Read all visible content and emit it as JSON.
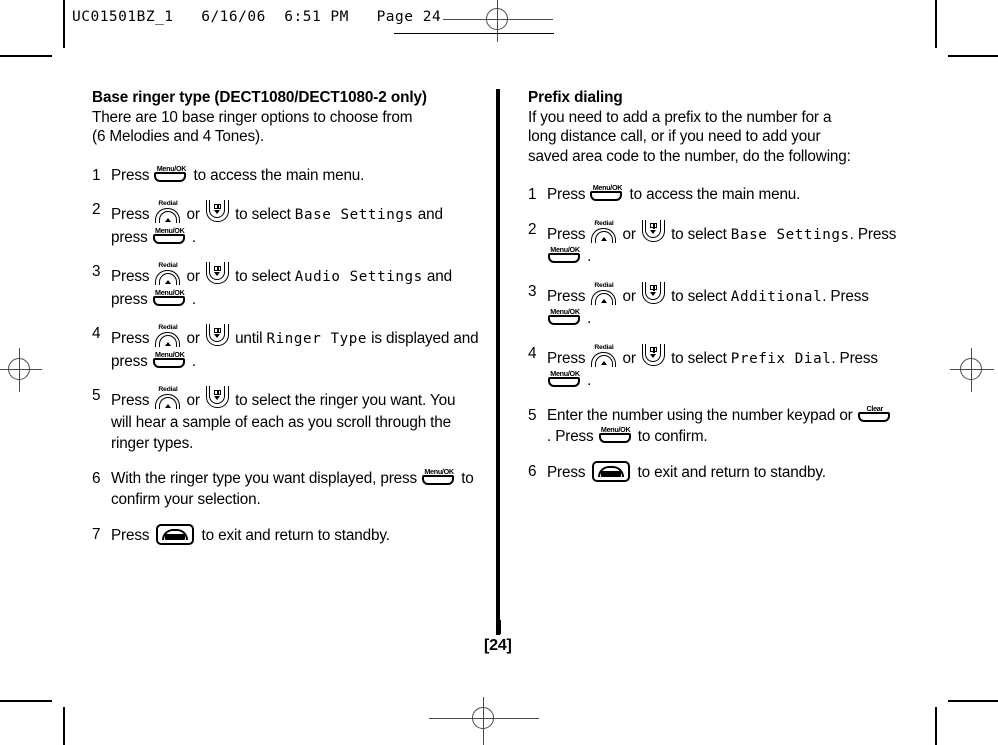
{
  "print_header": {
    "text": "UC01501BZ_1   6/16/06  6:51 PM   Page 24"
  },
  "left_column": {
    "title": "Base ringer type (DECT1080/DECT1080-2 only)",
    "intro_line1": "There are 10 base ringer options to choose from",
    "intro_line2": "(6 Melodies and 4 Tones).",
    "steps": [
      {
        "num": "1",
        "parts": [
          {
            "t": "text",
            "v": "Press "
          },
          {
            "t": "key-menuok",
            "v": "Menu/OK"
          },
          {
            "t": "text",
            "v": " to access the main menu."
          }
        ]
      },
      {
        "num": "2",
        "parts": [
          {
            "t": "text",
            "v": "Press "
          },
          {
            "t": "key-up",
            "v": "Redial"
          },
          {
            "t": "text",
            "v": " or "
          },
          {
            "t": "key-down",
            "v": "Phonebook Down"
          },
          {
            "t": "text",
            "v": " to select "
          },
          {
            "t": "lcd",
            "v": "Base Settings"
          },
          {
            "t": "text",
            "v": " and press "
          },
          {
            "t": "key-menuok",
            "v": "Menu/OK"
          },
          {
            "t": "text",
            "v": " ."
          }
        ]
      },
      {
        "num": "3",
        "parts": [
          {
            "t": "text",
            "v": "Press "
          },
          {
            "t": "key-up",
            "v": "Redial"
          },
          {
            "t": "text",
            "v": " or "
          },
          {
            "t": "key-down",
            "v": "Phonebook Down"
          },
          {
            "t": "text",
            "v": " to select "
          },
          {
            "t": "lcd",
            "v": "Audio Settings"
          },
          {
            "t": "text",
            "v": " and press "
          },
          {
            "t": "key-menuok",
            "v": "Menu/OK"
          },
          {
            "t": "text",
            "v": " ."
          }
        ]
      },
      {
        "num": "4",
        "parts": [
          {
            "t": "text",
            "v": "Press "
          },
          {
            "t": "key-up",
            "v": "Redial"
          },
          {
            "t": "text",
            "v": " or "
          },
          {
            "t": "key-down",
            "v": "Phonebook Down"
          },
          {
            "t": "text",
            "v": " until "
          },
          {
            "t": "lcd",
            "v": "Ringer Type"
          },
          {
            "t": "text",
            "v": " is displayed and press "
          },
          {
            "t": "key-menuok",
            "v": "Menu/OK"
          },
          {
            "t": "text",
            "v": " ."
          }
        ]
      },
      {
        "num": "5",
        "parts": [
          {
            "t": "text",
            "v": "Press "
          },
          {
            "t": "key-up",
            "v": "Redial"
          },
          {
            "t": "text",
            "v": " or "
          },
          {
            "t": "key-down",
            "v": "Phonebook Down"
          },
          {
            "t": "text",
            "v": " to select the ringer you want. You will hear a sample of each as you scroll through the ringer types."
          }
        ]
      },
      {
        "num": "6",
        "parts": [
          {
            "t": "text",
            "v": "With the ringer type you want displayed, press "
          },
          {
            "t": "key-menuok",
            "v": "Menu/OK"
          },
          {
            "t": "text",
            "v": " to confirm your selection."
          }
        ]
      },
      {
        "num": "7",
        "parts": [
          {
            "t": "text",
            "v": "Press "
          },
          {
            "t": "key-end",
            "v": "End Call"
          },
          {
            "t": "text",
            "v": " to exit and return to standby."
          }
        ]
      }
    ]
  },
  "right_column": {
    "title": "Prefix dialing",
    "intro_line1": "If you need to add a prefix to the number for a",
    "intro_line2": "long distance call, or if you need to add your",
    "intro_line3": "saved area code to the number, do the following:",
    "steps": [
      {
        "num": "1",
        "parts": [
          {
            "t": "text",
            "v": "Press "
          },
          {
            "t": "key-menuok",
            "v": "Menu/OK"
          },
          {
            "t": "text",
            "v": " to access the main menu."
          }
        ]
      },
      {
        "num": "2",
        "parts": [
          {
            "t": "text",
            "v": "Press "
          },
          {
            "t": "key-up",
            "v": "Redial"
          },
          {
            "t": "text",
            "v": " or "
          },
          {
            "t": "key-down",
            "v": "Phonebook Down"
          },
          {
            "t": "text",
            "v": " to select "
          },
          {
            "t": "lcd",
            "v": "Base Settings"
          },
          {
            "t": "text",
            "v": ". Press "
          },
          {
            "t": "key-menuok",
            "v": "Menu/OK"
          },
          {
            "t": "text",
            "v": " ."
          }
        ]
      },
      {
        "num": "3",
        "parts": [
          {
            "t": "text",
            "v": "Press "
          },
          {
            "t": "key-up",
            "v": "Redial"
          },
          {
            "t": "text",
            "v": " or "
          },
          {
            "t": "key-down",
            "v": "Phonebook Down"
          },
          {
            "t": "text",
            "v": " to select "
          },
          {
            "t": "lcd",
            "v": "Additional"
          },
          {
            "t": "text",
            "v": ". Press "
          },
          {
            "t": "key-menuok",
            "v": "Menu/OK"
          },
          {
            "t": "text",
            "v": " ."
          }
        ]
      },
      {
        "num": "4",
        "parts": [
          {
            "t": "text",
            "v": "Press "
          },
          {
            "t": "key-up",
            "v": "Redial"
          },
          {
            "t": "text",
            "v": " or "
          },
          {
            "t": "key-down",
            "v": "Phonebook Down"
          },
          {
            "t": "text",
            "v": " to select "
          },
          {
            "t": "lcd",
            "v": "Prefix Dial"
          },
          {
            "t": "text",
            "v": ". Press "
          },
          {
            "t": "key-menuok",
            "v": "Menu/OK"
          },
          {
            "t": "text",
            "v": " ."
          }
        ]
      },
      {
        "num": "5",
        "parts": [
          {
            "t": "text",
            "v": "Enter the number using the number keypad or "
          },
          {
            "t": "key-clear",
            "v": "Clear"
          },
          {
            "t": "text",
            "v": " . Press "
          },
          {
            "t": "key-menuok",
            "v": "Menu/OK"
          },
          {
            "t": "text",
            "v": " to confirm."
          }
        ]
      },
      {
        "num": "6",
        "parts": [
          {
            "t": "text",
            "v": "Press "
          },
          {
            "t": "key-end",
            "v": "End Call"
          },
          {
            "t": "text",
            "v": " to exit and return to standby."
          }
        ]
      }
    ]
  },
  "footer": {
    "page_number": "[24]"
  }
}
